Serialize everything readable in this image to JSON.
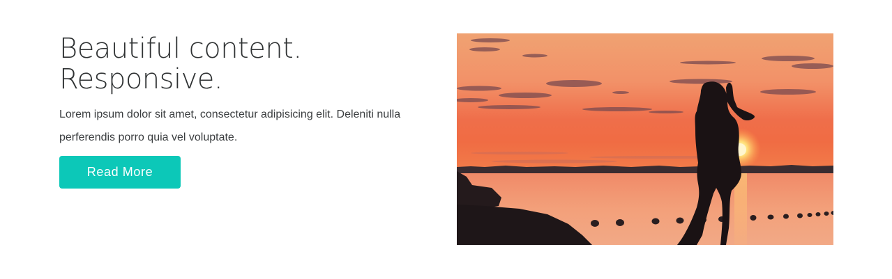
{
  "hero": {
    "headline_line1": "Beautiful content.",
    "headline_line2": "Responsive.",
    "body": "Lorem ipsum dolor sit amet, consectetur adipisicing elit. Deleniti nulla perferendis porro quia vel voluptate.",
    "button_label": "Read More"
  },
  "colors": {
    "button": "#0cc8b8",
    "headline": "#2f3233",
    "body_text": "#3a3d3f"
  }
}
